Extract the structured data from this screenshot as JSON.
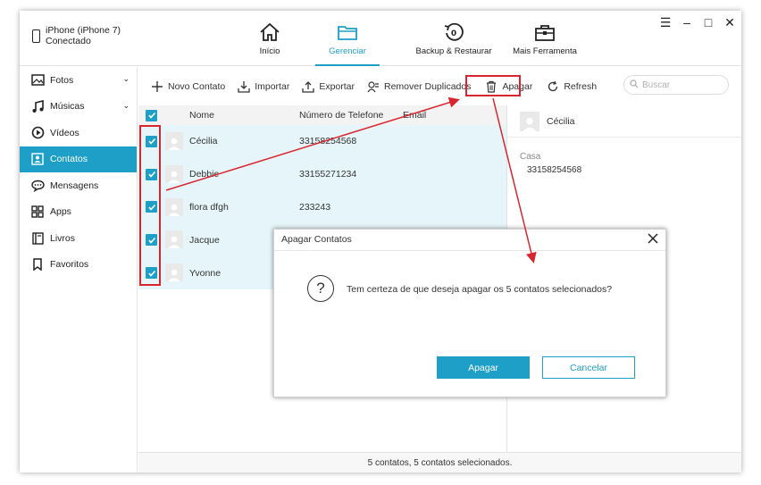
{
  "device": {
    "name": "iPhone (iPhone 7)",
    "status": "Conectado"
  },
  "nav": [
    {
      "label": "Início",
      "icon": "home-icon"
    },
    {
      "label": "Gerenciar",
      "icon": "folder-icon",
      "active": true
    },
    {
      "label": "Backup & Restaurar",
      "icon": "backup-restore-icon"
    },
    {
      "label": "Mais Ferramenta",
      "icon": "toolbox-icon"
    }
  ],
  "window_controls": {
    "menu": "☰",
    "minimize": "–",
    "maximize": "□",
    "close": "✕"
  },
  "sidebar": {
    "items": [
      {
        "label": "Fotos",
        "icon": "photo-icon",
        "chevron": "⌄"
      },
      {
        "label": "Músicas",
        "icon": "music-icon",
        "chevron": "⌄"
      },
      {
        "label": "Vídeos",
        "icon": "video-icon"
      },
      {
        "label": "Contatos",
        "icon": "contacts-icon",
        "active": true
      },
      {
        "label": "Mensagens",
        "icon": "messages-icon"
      },
      {
        "label": "Apps",
        "icon": "apps-icon"
      },
      {
        "label": "Livros",
        "icon": "books-icon"
      },
      {
        "label": "Favoritos",
        "icon": "bookmark-icon"
      }
    ]
  },
  "toolbar": {
    "new_contact": "Novo Contato",
    "import": "Importar",
    "export": "Exportar",
    "remove_duplicates": "Remover Duplicados",
    "delete": "Apagar",
    "refresh": "Refresh",
    "search_placeholder": "Buscar"
  },
  "table": {
    "headers": {
      "name": "Nome",
      "phone": "Número de Telefone",
      "email": "Email"
    },
    "rows": [
      {
        "name": "Cécilia",
        "phone": "33158254568"
      },
      {
        "name": "Debbie",
        "phone": "33155271234"
      },
      {
        "name": "flora dfgh",
        "phone": "233243"
      },
      {
        "name": "Jacque",
        "phone": ""
      },
      {
        "name": "Yvonne",
        "phone": ""
      }
    ]
  },
  "detail": {
    "name": "Cécilia",
    "label": "Casa",
    "value": "33158254568"
  },
  "status": "5 contatos, 5 contatos selecionados.",
  "dialog": {
    "title": "Apagar Contatos",
    "message": "Tem certeza de que deseja apagar os 5 contatos selecionados?",
    "confirm": "Apagar",
    "cancel": "Cancelar",
    "question_glyph": "?"
  },
  "colors": {
    "accent": "#1e9fc7",
    "annotation": "#d9262e",
    "row_selected": "#e6f5f9"
  }
}
